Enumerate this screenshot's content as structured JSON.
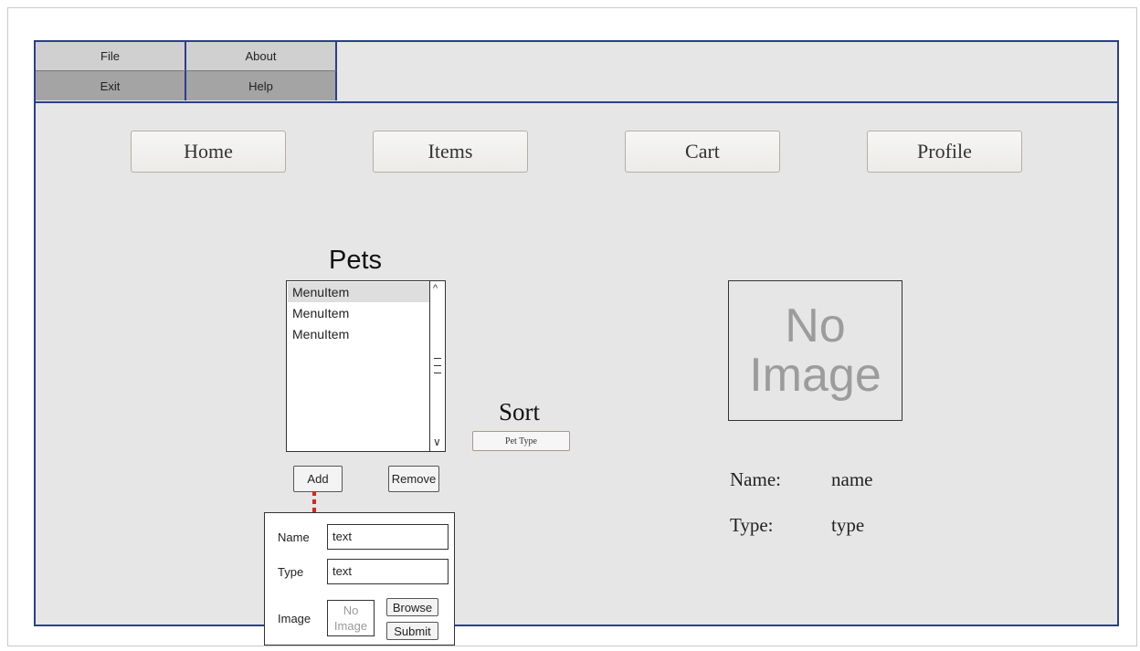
{
  "menu": {
    "file": "File",
    "about": "About",
    "exit": "Exit",
    "help": "Help"
  },
  "nav": {
    "home": "Home",
    "items": "Items",
    "cart": "Cart",
    "profile": "Profile"
  },
  "pets": {
    "title": "Pets",
    "items": [
      "MenuItem",
      "MenuItem",
      "MenuItem"
    ],
    "add_label": "Add",
    "remove_label": "Remove"
  },
  "sort": {
    "label": "Sort",
    "button": "Pet Type"
  },
  "preview": {
    "image_line1": "No",
    "image_line2": "Image"
  },
  "details": {
    "name_label": "Name:",
    "name_value": "name",
    "type_label": "Type:",
    "type_value": "type"
  },
  "add_form": {
    "name_label": "Name",
    "name_value": "text",
    "type_label": "Type",
    "type_value": "text",
    "image_label": "Image",
    "image_line1": "No",
    "image_line2": "Image",
    "browse_label": "Browse",
    "submit_label": "Submit"
  },
  "colors": {
    "frame": "#2c3e8c",
    "panel": "#e6e6e6",
    "connector": "#d8261b"
  }
}
